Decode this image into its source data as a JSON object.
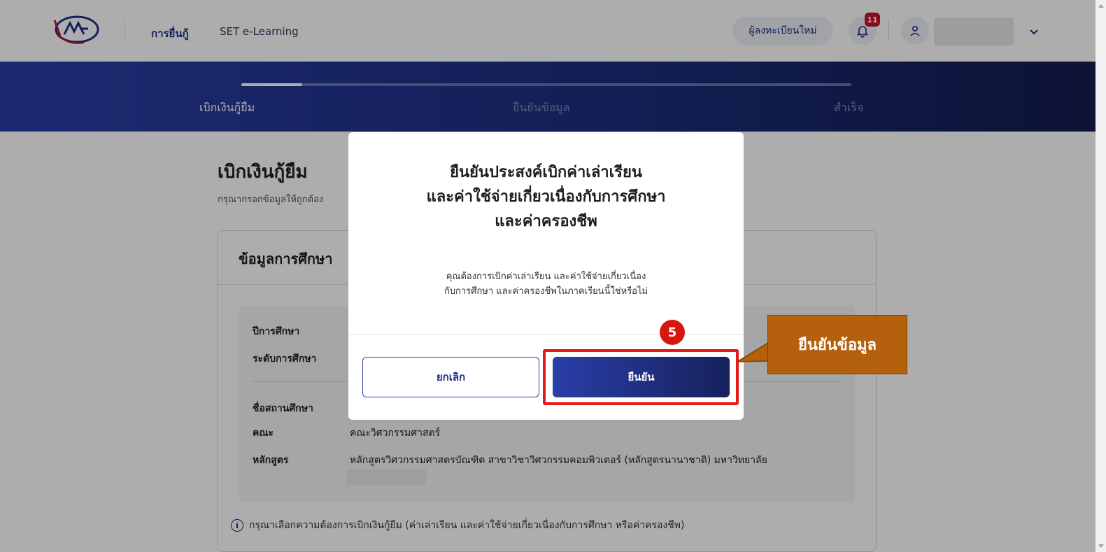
{
  "header": {
    "logo_icon": "kyslf-logo-icon",
    "nav": [
      "การยื่นกู้",
      "SET e-Learning"
    ],
    "register_button": "ผู้ลงทะเบียนใหม่",
    "notification_count": "11",
    "notification_icon": "bell-icon",
    "user_icon": "user-icon",
    "menu_icon": "chevron-down-icon"
  },
  "progress": {
    "steps": [
      "เบิกเงินกู้ยืม",
      "ยืนยันข้อมูล",
      "สำเร็จ"
    ],
    "active_step": 0,
    "fill_fraction": 0.1
  },
  "main": {
    "title": "เบิกเงินกู้ยืม",
    "subtitle": "กรุณากรอกข้อมูลให้ถูกต้อง",
    "card_title": "ข้อมูลการศึกษา",
    "rows": [
      {
        "label": "ปีการศึกษา",
        "value": ""
      },
      {
        "label": "ระดับการศึกษา",
        "value": ""
      },
      {
        "label": "ชื่อสถานศึกษา",
        "value": ""
      },
      {
        "label": "คณะ",
        "value": "คณะวิศวกรรมศาสตร์"
      },
      {
        "label": "หลักสูตร",
        "value": "หลักสูตรวิศวกรรมศาสตรบัณฑิต สาขาวิชาวิศวกรรมคอมพิวเตอร์ (หลักสูตรนานาชาติ) มหาวิทยาลัย"
      }
    ],
    "note": "กรุณาเลือกความต้องการเบิกเงินกู้ยืม (ค่าเล่าเรียน และค่าใช้จ่ายเกี่ยวเนื่องกับการศึกษา หรือค่าครองชีพ)",
    "note_icon": "info-icon"
  },
  "modal": {
    "title_lines": [
      "ยืนยันประสงค์เบิกค่าเล่าเรียน",
      "และค่าใช้จ่ายเกี่ยวเนื่องกับการศึกษา",
      "และค่าครองชีพ"
    ],
    "body_lines": [
      "คุณต้องการเบิกค่าเล่าเรียน และค่าใช้จ่ายเกี่ยวเนื่อง",
      "กับการศึกษา และค่าครองชีพในภาคเรียนนี้ใช่หรือไม่"
    ],
    "cancel": "ยกเลิก",
    "confirm": "ยืนยัน"
  },
  "annotation": {
    "step_number": "5",
    "callout_text": "ยืนยันข้อมูล",
    "highlight_color": "#e41b17",
    "callout_color": "#b4600c"
  },
  "colors": {
    "brand_navy": "#1d2f8c",
    "banner_dark": "#131c4e",
    "badge_red": "#c8102e"
  }
}
